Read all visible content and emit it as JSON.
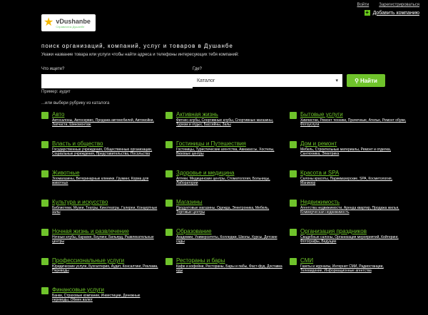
{
  "topbar": {
    "login": "Войти",
    "register": "Зарегистрироваться"
  },
  "add_company": "Добавить компанию",
  "logo": {
    "name": "vDushanbe",
    "subtitle": "Справочник Душанбе"
  },
  "search": {
    "heading": "поиск организаций, компаний, услуг и товаров в Душанбе",
    "hint": "Укажи название товара или услуги чтобы найти адреса и телефоны интересующих тебя компаний:",
    "what_label": "Что ищете?",
    "where_label": "Где?",
    "what_value": "",
    "category_select": "Каталог",
    "button": "Найти",
    "example": "Пример: аудит",
    "choose_hint": "...или выбери рубрику из каталога"
  },
  "categories": [
    {
      "icon": "car-icon",
      "title": "Авто",
      "sub": "Автосалоны, Автосервис, Продажа автомобилей, Автомойки, Запчасти, Шиномонтаж"
    },
    {
      "icon": "bike-icon",
      "title": "Активная жизнь",
      "sub": "Фитнес-клубы, Спортивные клубы, Спортивные магазины, Туризм и отдых, Бассейны, Залы"
    },
    {
      "icon": "sofa-icon",
      "title": "Бытовые услуги",
      "sub": "Химчистки, Ремонт техники, Прачечные, Ателье, Ремонт обуви, Фотоуслуги"
    },
    {
      "icon": "building-icon",
      "title": "Власть и общество",
      "sub": "Государственные учреждения, Общественные организации, Социальные учреждения, Представительства, Посольства"
    },
    {
      "icon": "hotel-icon",
      "title": "Гостиницы и Путешествия",
      "sub": "Гостиницы, Туристические агентства, Авиакассы, Хостелы, Визовые центры"
    },
    {
      "icon": "house-icon",
      "title": "Дом и ремонт",
      "sub": "Мебель, Строительные материалы, Ремонт и отделка, Сантехника, Электрика"
    },
    {
      "icon": "paw-icon",
      "title": "Животные",
      "sub": "Зоомагазины, Ветеринарные клиники, Груминг, Корма для животных"
    },
    {
      "icon": "medical-icon",
      "title": "Здоровье и медицина",
      "sub": "Аптеки, Медицинские центры, Стоматология, Больницы, Лаборатории"
    },
    {
      "icon": "beauty-icon",
      "title": "Красота и SPA",
      "sub": "Салоны красоты, Парикмахерские, SPA, Косметология, Маникюр"
    },
    {
      "icon": "music-icon",
      "title": "Культура и искусство",
      "sub": "Библиотеки, Музеи, Театры, Кинотеатры, Галереи, Концертные залы"
    },
    {
      "icon": "shop-icon",
      "title": "Магазины",
      "sub": "Продуктовые магазины, Одежда, Электроника, Мебель, Торговые центры"
    },
    {
      "icon": "realty-icon",
      "title": "Недвижимость",
      "sub": "Агентства недвижимости, Аренда квартир, Продажа жилья, Коммерческая недвижимость"
    },
    {
      "icon": "night-icon",
      "title": "Ночная жизнь и развлечение",
      "sub": "Ночные клубы, Караоке, Боулинг, Бильярд, Развлекательные центры"
    },
    {
      "icon": "education-icon",
      "title": "Образование",
      "sub": "Академии, Университеты, Колледжи, Школы, Курсы, Детские сады"
    },
    {
      "icon": "party-icon",
      "title": "Организация праздников",
      "sub": "Свадебные салоны, Организация мероприятий, Кейтеринг, Фотографы, Ведущие"
    },
    {
      "icon": "pro-icon",
      "title": "Профессиональные услуги",
      "sub": "Юридические услуги, Бухгалтерия, Аудит, Консалтинг, Реклама, Переводы"
    },
    {
      "icon": "food-icon",
      "title": "Рестораны и бары",
      "sub": "Кафе и кофейни, Рестораны, Бары и пабы, Фаст-фуд, Доставка еды"
    },
    {
      "icon": "media-icon",
      "title": "СМИ",
      "sub": "Газеты и журналы, Интернет СМИ, Радиостанции, Телевидение, Информационные агентства"
    },
    {
      "icon": "finance-icon",
      "title": "Финансовые услуги",
      "sub": "Банки, Страховые компании, Инвестиции, Денежные переводы, Обмен валют"
    }
  ]
}
